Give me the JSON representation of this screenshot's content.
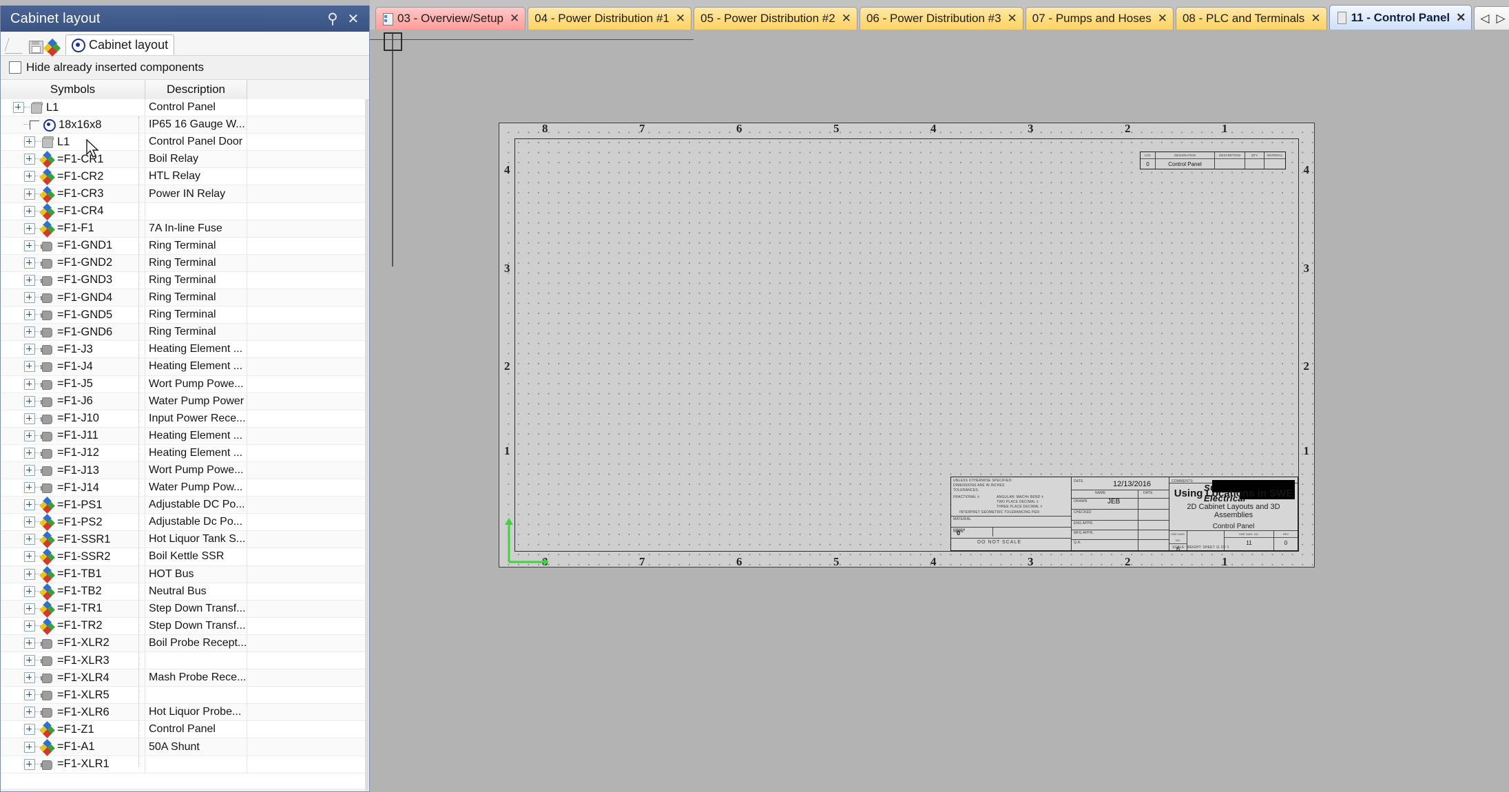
{
  "panel": {
    "title": "Cabinet layout",
    "pin_icon": "pin-icon",
    "close_icon": "close-icon",
    "toolbar": {
      "save_icon": "save-icon",
      "diamond_icon": "diamond-icon",
      "tab_icon": "target-icon",
      "tab_label": "Cabinet layout"
    },
    "hide_checkbox_label": "Hide already inserted components",
    "columns": [
      "Symbols",
      "Description",
      ""
    ],
    "rows": [
      {
        "indent": 0,
        "icon": "cube",
        "symbol": "L1",
        "description": "Control Panel",
        "expander": true
      },
      {
        "indent": 1,
        "icon": "circle",
        "symbol": "18x16x8",
        "description": "IP65 16 Gauge W...",
        "expander": false,
        "corner": true
      },
      {
        "indent": 1,
        "icon": "cube",
        "symbol": "L1",
        "description": "Control Panel Door",
        "expander": true
      },
      {
        "indent": 1,
        "icon": "diamond",
        "symbol": "=F1-CR1",
        "description": "Boil Relay",
        "expander": true
      },
      {
        "indent": 1,
        "icon": "diamond",
        "symbol": "=F1-CR2",
        "description": "HTL Relay",
        "expander": true
      },
      {
        "indent": 1,
        "icon": "diamond",
        "symbol": "=F1-CR3",
        "description": "Power IN Relay",
        "expander": true
      },
      {
        "indent": 1,
        "icon": "diamond",
        "symbol": "=F1-CR4",
        "description": "",
        "expander": true
      },
      {
        "indent": 1,
        "icon": "diamond",
        "symbol": "=F1-F1",
        "description": "7A In-line Fuse",
        "expander": true
      },
      {
        "indent": 1,
        "icon": "terminal",
        "symbol": "=F1-GND1",
        "description": "Ring Terminal",
        "expander": true
      },
      {
        "indent": 1,
        "icon": "terminal",
        "symbol": "=F1-GND2",
        "description": "Ring Terminal",
        "expander": true
      },
      {
        "indent": 1,
        "icon": "terminal",
        "symbol": "=F1-GND3",
        "description": "Ring Terminal",
        "expander": true
      },
      {
        "indent": 1,
        "icon": "terminal",
        "symbol": "=F1-GND4",
        "description": "Ring Terminal",
        "expander": true
      },
      {
        "indent": 1,
        "icon": "terminal",
        "symbol": "=F1-GND5",
        "description": "Ring Terminal",
        "expander": true
      },
      {
        "indent": 1,
        "icon": "terminal",
        "symbol": "=F1-GND6",
        "description": "Ring Terminal",
        "expander": true
      },
      {
        "indent": 1,
        "icon": "terminal",
        "symbol": "=F1-J3",
        "description": "Heating Element ...",
        "expander": true
      },
      {
        "indent": 1,
        "icon": "terminal",
        "symbol": "=F1-J4",
        "description": "Heating Element ...",
        "expander": true
      },
      {
        "indent": 1,
        "icon": "terminal",
        "symbol": "=F1-J5",
        "description": "Wort Pump Powe...",
        "expander": true
      },
      {
        "indent": 1,
        "icon": "terminal",
        "symbol": "=F1-J6",
        "description": "Water Pump Power",
        "expander": true
      },
      {
        "indent": 1,
        "icon": "terminal",
        "symbol": "=F1-J10",
        "description": "Input Power Rece...",
        "expander": true
      },
      {
        "indent": 1,
        "icon": "terminal",
        "symbol": "=F1-J11",
        "description": "Heating Element ...",
        "expander": true
      },
      {
        "indent": 1,
        "icon": "terminal",
        "symbol": "=F1-J12",
        "description": "Heating Element ...",
        "expander": true
      },
      {
        "indent": 1,
        "icon": "terminal",
        "symbol": "=F1-J13",
        "description": "Wort Pump Powe...",
        "expander": true
      },
      {
        "indent": 1,
        "icon": "terminal",
        "symbol": "=F1-J14",
        "description": "Water Pump Pow...",
        "expander": true
      },
      {
        "indent": 1,
        "icon": "diamond",
        "symbol": "=F1-PS1",
        "description": "Adjustable DC Po...",
        "expander": true
      },
      {
        "indent": 1,
        "icon": "diamond",
        "symbol": "=F1-PS2",
        "description": "Adjustable Dc Po...",
        "expander": true
      },
      {
        "indent": 1,
        "icon": "diamond",
        "symbol": "=F1-SSR1",
        "description": "Hot Liquor Tank S...",
        "expander": true
      },
      {
        "indent": 1,
        "icon": "diamond",
        "symbol": "=F1-SSR2",
        "description": "Boil Kettle SSR",
        "expander": true
      },
      {
        "indent": 1,
        "icon": "diamond",
        "symbol": "=F1-TB1",
        "description": "HOT Bus",
        "expander": true
      },
      {
        "indent": 1,
        "icon": "diamond",
        "symbol": "=F1-TB2",
        "description": "Neutral Bus",
        "expander": true
      },
      {
        "indent": 1,
        "icon": "diamond",
        "symbol": "=F1-TR1",
        "description": "Step Down Transf...",
        "expander": true
      },
      {
        "indent": 1,
        "icon": "diamond",
        "symbol": "=F1-TR2",
        "description": "Step Down Transf...",
        "expander": true
      },
      {
        "indent": 1,
        "icon": "terminal",
        "symbol": "=F1-XLR2",
        "description": "Boil Probe Recept...",
        "expander": true
      },
      {
        "indent": 1,
        "icon": "terminal",
        "symbol": "=F1-XLR3",
        "description": "",
        "expander": true
      },
      {
        "indent": 1,
        "icon": "terminal",
        "symbol": "=F1-XLR4",
        "description": "Mash Probe Rece...",
        "expander": true
      },
      {
        "indent": 1,
        "icon": "terminal",
        "symbol": "=F1-XLR5",
        "description": "",
        "expander": true
      },
      {
        "indent": 1,
        "icon": "terminal",
        "symbol": "=F1-XLR6",
        "description": "Hot Liquor Probe...",
        "expander": true
      },
      {
        "indent": 1,
        "icon": "diamond",
        "symbol": "=F1-Z1",
        "description": "Control Panel",
        "expander": true
      },
      {
        "indent": 1,
        "icon": "diamond",
        "symbol": "=F1-A1",
        "description": "50A Shunt",
        "expander": true
      },
      {
        "indent": 1,
        "icon": "terminal",
        "symbol": "=F1-XLR1",
        "description": "",
        "expander": true
      }
    ]
  },
  "document_tabs": {
    "tabs": [
      {
        "label": "03 - Overview/Setup",
        "icon": "book-icon",
        "color": "red",
        "active": false,
        "close": "✕"
      },
      {
        "label": "04 - Power Distribution #1",
        "icon": "scheme-icon",
        "color": "yellow",
        "active": false,
        "close": "✕"
      },
      {
        "label": "05 - Power Distribution #2",
        "icon": "scheme-icon",
        "color": "yellow",
        "active": false,
        "close": "✕"
      },
      {
        "label": "06 - Power Distribution #3",
        "icon": "scheme-icon",
        "color": "yellow",
        "active": false,
        "close": "✕"
      },
      {
        "label": "07 - Pumps and Hoses",
        "icon": "scheme-icon",
        "color": "yellow",
        "active": false,
        "close": "✕"
      },
      {
        "label": "08 - PLC and Terminals",
        "icon": "scheme-icon",
        "color": "yellow",
        "active": false,
        "close": "✕"
      },
      {
        "label": "11 - Control Panel",
        "icon": "cabinet-icon",
        "color": "blue",
        "active": true,
        "close": "✕"
      }
    ],
    "nav_prev": "◁",
    "nav_next": "▷",
    "nav_close": "✕"
  },
  "drawing": {
    "zones_top": [
      "8",
      "7",
      "6",
      "5",
      "4",
      "3",
      "2",
      "1"
    ],
    "zones_bottom": [
      "8",
      "7",
      "6",
      "5",
      "4",
      "3",
      "2",
      "1"
    ],
    "zones_left": [
      "4",
      "3",
      "2",
      "1"
    ],
    "zones_right": [
      "4",
      "3",
      "2",
      "1"
    ],
    "ucs_icon": "ucs-axes-icon",
    "crosshair_icon": "crosshair-cursor",
    "revision_table": {
      "headers": [
        "LOC",
        "DESIGNATION",
        "DESCRIPTION",
        "QTY",
        "MATERIAL"
      ],
      "row": [
        "0",
        "Control Panel",
        "",
        "",
        ""
      ]
    },
    "title_block": {
      "logo_text": "SOLIDWORKS Electrical",
      "title": "Using Locations in SWE",
      "subtitle": "2D Cabinet Layouts and 3D Assemblies",
      "subtitle2": "Control Panel",
      "date_label": "DATE",
      "date": "12/13/2016",
      "drawn_by": "JEB",
      "do_not_scale": "DO NOT SCALE",
      "size": "B",
      "sheet_number": "11",
      "rev": "0",
      "micro_notes": [
        "UNLESS OTHERWISE SPECIFIED:",
        "DIMENSIONS ARE IN INCHES",
        "TOLERANCES:",
        "FRACTIONAL ±",
        "ANGULAR: MACH± BEND ±",
        "TWO PLACE DECIMAL ±",
        "THREE PLACE DECIMAL ±",
        "INTERPRET GEOMETRIC TOLERANCING PER:",
        "MATERIAL",
        "FINISH",
        "NAME",
        "DATE",
        "DRAWN",
        "CHECKED",
        "ENG APPR.",
        "MFG APPR.",
        "Q.A.",
        "COMMENTS:",
        "SIZE DWG. NO.",
        "SCALE:  WEIGHT:   SHEET 11 OF 1"
      ]
    }
  },
  "colors": {
    "panel_title_bg": "#3d5a8a",
    "tab_active_bg": "#dce8fb",
    "tab_yellow_bg": "#ffd268",
    "tab_red_bg": "#ffb0ae",
    "canvas_bg": "#b3b3b3",
    "sheet_bg": "#cfcfcf",
    "ucs_green": "#3fd43f"
  }
}
